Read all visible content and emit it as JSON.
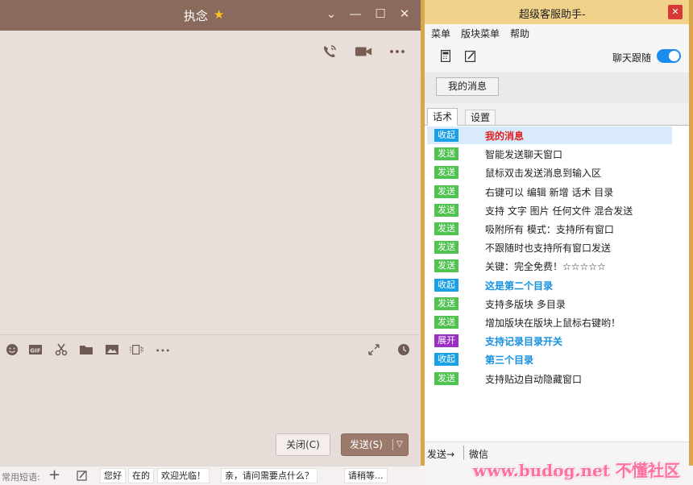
{
  "chat": {
    "title": "执念",
    "window_controls": [
      "chevron-down-icon",
      "minimize-icon",
      "maximize-icon",
      "close-icon"
    ],
    "call_icons": [
      "phone-icon",
      "video-icon",
      "more-icon"
    ],
    "toolbar_icons": [
      "emoji-icon",
      "gif-icon",
      "scissors-icon",
      "folder-icon",
      "image-icon",
      "screen-share-icon",
      "more-icon",
      "expand-icon",
      "history-icon"
    ],
    "close_button": "关闭(C)",
    "send_button": "发送(S)"
  },
  "quick_phrases": {
    "label": "常用短语:",
    "items": [
      "您好",
      "在的",
      "欢迎光临！",
      "亲，请问需要点什么？",
      "请稍等..."
    ]
  },
  "helper": {
    "title": "超级客服助手-",
    "menu": [
      "菜单",
      "版块菜单",
      "帮助"
    ],
    "follow_label": "聊天跟随",
    "follow_on": true,
    "my_messages_button": "我的消息",
    "tabs": [
      "话术",
      "设置"
    ],
    "rows": [
      {
        "badge": "收起",
        "text": "我的消息",
        "style": "red",
        "badge_color": "#19a0e6"
      },
      {
        "badge": "发送",
        "text": "智能发送聊天窗口",
        "style": "normal",
        "badge_color": "#4fc24f"
      },
      {
        "badge": "发送",
        "text": "鼠标双击发送消息到输入区",
        "style": "normal",
        "badge_color": "#4fc24f"
      },
      {
        "badge": "发送",
        "text": "右键可以 编辑 新增 话术 目录",
        "style": "normal",
        "badge_color": "#4fc24f"
      },
      {
        "badge": "发送",
        "text": "支持 文字 图片 任何文件 混合发送",
        "style": "normal",
        "badge_color": "#4fc24f"
      },
      {
        "badge": "发送",
        "text": "吸附所有 模式：支持所有窗口",
        "style": "normal",
        "badge_color": "#4fc24f"
      },
      {
        "badge": "发送",
        "text": "不跟随时也支持所有窗口发送",
        "style": "normal",
        "badge_color": "#4fc24f"
      },
      {
        "badge": "发送",
        "text": "关键：完全免费！☆☆☆☆☆",
        "style": "normal",
        "badge_color": "#4fc24f"
      },
      {
        "badge": "收起",
        "text": "这是第二个目录",
        "style": "blue",
        "badge_color": "#19a0e6"
      },
      {
        "badge": "发送",
        "text": "支持多版块 多目录",
        "style": "normal",
        "badge_color": "#4fc24f"
      },
      {
        "badge": "发送",
        "text": "增加版块在版块上鼠标右键哟！",
        "style": "normal",
        "badge_color": "#4fc24f"
      },
      {
        "badge": "展开",
        "text": "支持记录目录开关",
        "style": "blue",
        "badge_color": "#9b2fc4"
      },
      {
        "badge": "收起",
        "text": "第三个目录",
        "style": "blue",
        "badge_color": "#19a0e6"
      },
      {
        "badge": "发送",
        "text": "支持贴边自动隐藏窗口",
        "style": "normal",
        "badge_color": "#4fc24f"
      }
    ],
    "status_send": "发送→",
    "status_target": "微信"
  },
  "watermark": "www.budog.net 不懂社区"
}
